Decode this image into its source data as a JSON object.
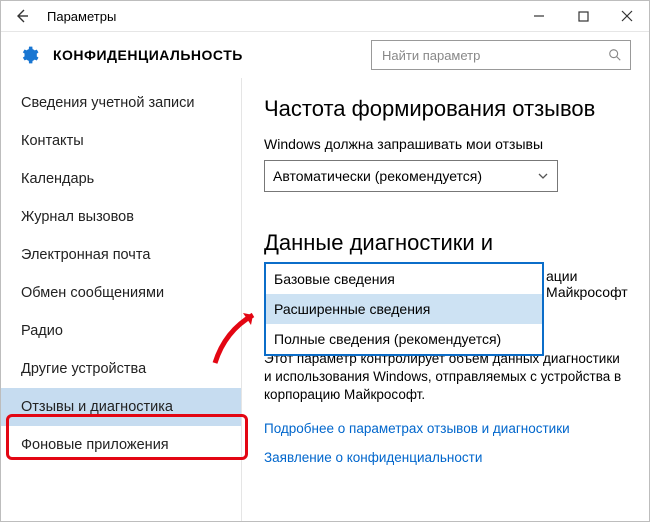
{
  "titlebar": {
    "title": "Параметры"
  },
  "header": {
    "label": "КОНФИДЕНЦИАЛЬНОСТЬ"
  },
  "search": {
    "placeholder": "Найти параметр"
  },
  "sidebar": {
    "items": [
      {
        "label": "Сведения учетной записи"
      },
      {
        "label": "Контакты"
      },
      {
        "label": "Календарь"
      },
      {
        "label": "Журнал вызовов"
      },
      {
        "label": "Электронная почта"
      },
      {
        "label": "Обмен сообщениями"
      },
      {
        "label": "Радио"
      },
      {
        "label": "Другие устройства"
      },
      {
        "label": "Отзывы и диагностика",
        "active": true
      },
      {
        "label": "Фоновые приложения"
      }
    ]
  },
  "content": {
    "section1_title": "Частота формирования отзывов",
    "section1_label": "Windows должна запрашивать мои отзывы",
    "section1_select_value": "Автоматически (рекомендуется)",
    "section2_title": "Данные диагностики и использования",
    "dd_options": [
      {
        "label": "Базовые сведения"
      },
      {
        "label": "Расширенные сведения",
        "selected": true
      },
      {
        "label": "Полные сведения (рекомендуется)"
      }
    ],
    "desc_tail": "ации Майкрософт",
    "desc_line2": "Этот параметр контролирует объем данных диагностики и использования Windows, отправляемых с устройства в корпорацию Майкрософт.",
    "link1": "Подробнее о параметрах отзывов и диагностики",
    "link2": "Заявление о конфиденциальности"
  }
}
